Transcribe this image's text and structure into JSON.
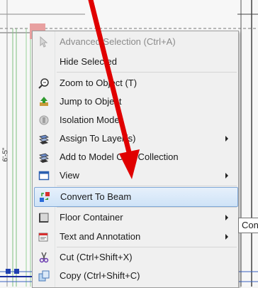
{
  "menu": {
    "items": [
      {
        "label": "Advanced Selection (Ctrl+A)",
        "icon": "pointer-icon",
        "disabled": true
      },
      {
        "label": "Hide Selected",
        "icon": "",
        "bold": true
      },
      {
        "label": "Zoom to Object (T)",
        "icon": "zoom-icon"
      },
      {
        "label": "Jump to Object",
        "icon": "jump-icon"
      },
      {
        "label": "Isolation Mode",
        "icon": "isolation-icon"
      },
      {
        "label": "Assign To Layer(s)",
        "icon": "layer-icon",
        "submenu": true
      },
      {
        "label": "Add to Model Only Collection",
        "icon": "layer-add-icon"
      },
      {
        "label": "View",
        "icon": "view-icon",
        "submenu": true
      },
      {
        "label": "Convert To Beam",
        "icon": "convert-icon",
        "highlighted": true
      },
      {
        "label": "Floor Container",
        "icon": "floor-icon",
        "submenu": true
      },
      {
        "label": "Text and Annotation",
        "icon": "text-icon",
        "submenu": true
      },
      {
        "label": "Cut (Ctrl+Shift+X)",
        "icon": "scissors-icon"
      },
      {
        "label": "Copy (Ctrl+Shift+C)",
        "icon": "copy-icon"
      }
    ]
  },
  "tooltip": {
    "text": "Con"
  },
  "background": {
    "dimension_label": "6'-5\""
  },
  "colors": {
    "arrow": "#e00000",
    "highlight": "#cfe3f7",
    "selection_marker": "#e8a0a0"
  }
}
